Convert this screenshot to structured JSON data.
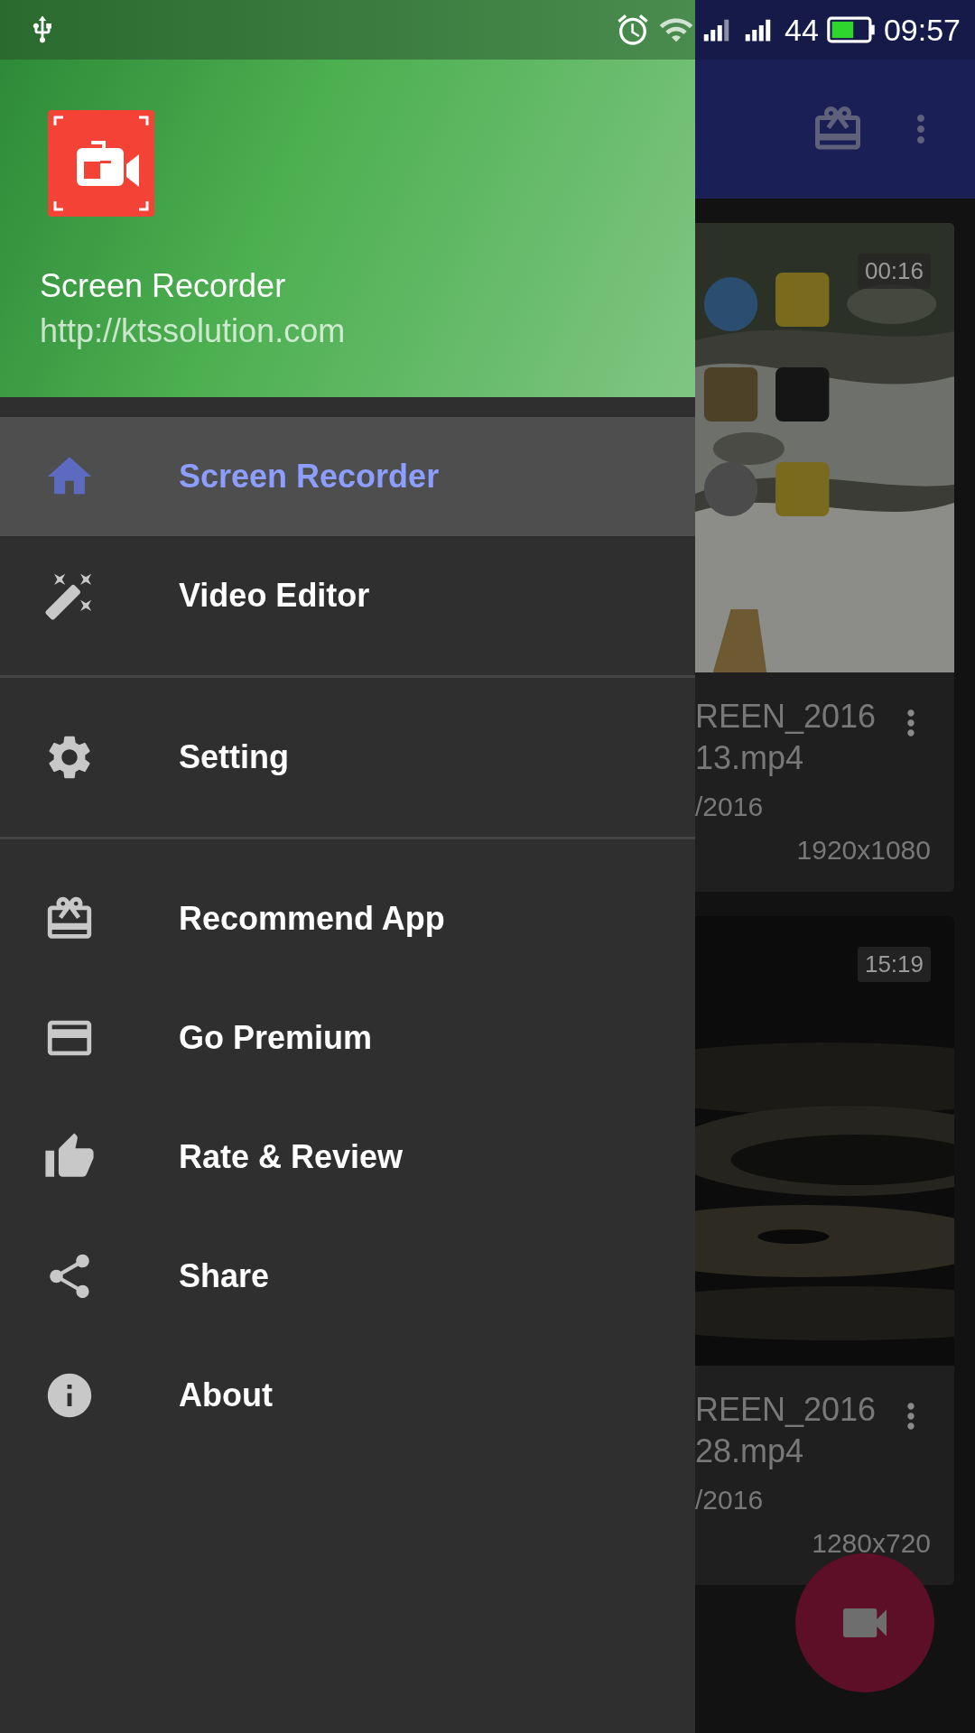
{
  "status_bar": {
    "battery_text": "44",
    "time": "09:57"
  },
  "drawer": {
    "header": {
      "title": "Screen Recorder",
      "url": "http://ktssolution.com"
    },
    "groups": [
      {
        "items": [
          {
            "label": "Screen Recorder",
            "selected": true
          },
          {
            "label": "Video Editor",
            "selected": false
          }
        ]
      },
      {
        "items": [
          {
            "label": "Setting",
            "selected": false
          }
        ]
      },
      {
        "items": [
          {
            "label": "Recommend App",
            "selected": false
          },
          {
            "label": "Go Premium",
            "selected": false
          },
          {
            "label": "Rate & Review",
            "selected": false
          },
          {
            "label": "Share",
            "selected": false
          },
          {
            "label": "About",
            "selected": false
          }
        ]
      }
    ]
  },
  "recordings": [
    {
      "duration": "00:16",
      "name_line_1": "REEN_2016",
      "name_line_2": "13.mp4",
      "date": "/2016",
      "resolution": "1920x1080"
    },
    {
      "duration": "15:19",
      "name_line_1": "REEN_2016",
      "name_line_2": "28.mp4",
      "date": "/2016",
      "resolution": "1280x720"
    }
  ]
}
